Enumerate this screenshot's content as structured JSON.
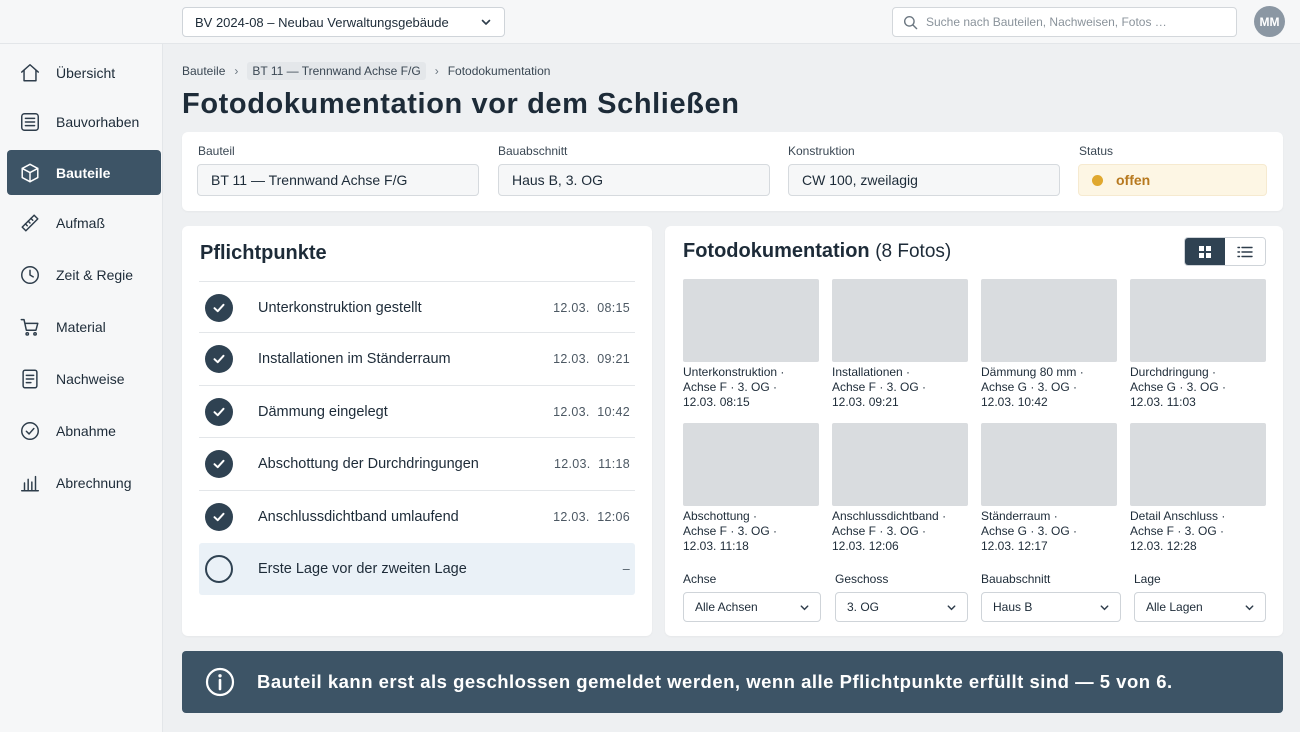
{
  "header": {
    "project_select": "BV 2024-08 – Neubau Verwaltungsgebäude",
    "search_placeholder": "Suche nach Bauteilen, Nachweisen, Fotos …",
    "avatar_initials": "MM"
  },
  "sidebar": {
    "items": [
      {
        "label": "Übersicht",
        "icon": "home-icon"
      },
      {
        "label": "Bauvorhaben",
        "icon": "building-icon"
      },
      {
        "label": "Bauteile",
        "icon": "cube-icon",
        "active": true
      },
      {
        "label": "Aufmaß",
        "icon": "ruler-icon"
      },
      {
        "label": "Zeit & Regie",
        "icon": "clock-icon"
      },
      {
        "label": "Material",
        "icon": "cart-icon"
      },
      {
        "label": "Nachweise",
        "icon": "document-icon"
      },
      {
        "label": "Abnahme",
        "icon": "check-circle-icon"
      },
      {
        "label": "Abrechnung",
        "icon": "bar-chart-icon"
      }
    ]
  },
  "breadcrumb": [
    "Bauteile",
    "BT 11 — Trennwand Achse F/G",
    "Fotodokumentation"
  ],
  "page_title": "Fotodokumentation vor dem Schließen",
  "info": {
    "bauteil_label": "Bauteil",
    "bauteil_value": "BT 11 — Trennwand Achse F/G",
    "bauabschnitt_label": "Bauabschnitt",
    "bauabschnitt_value": "Haus B, 3. OG",
    "konstruktion_label": "Konstruktion",
    "konstruktion_value": "CW 100, zweilagig",
    "status_label": "Status",
    "status_value": "offen",
    "status_color": "#e0a82e"
  },
  "checklist": {
    "title": "Pflichtpunkte",
    "items": [
      {
        "text": "Unterkonstruktion gestellt",
        "date": "12.03.",
        "time": "08:15",
        "done": true
      },
      {
        "text": "Installationen im Ständerraum",
        "date": "12.03.",
        "time": "09:21",
        "done": true
      },
      {
        "text": "Dämmung eingelegt",
        "date": "12.03.",
        "time": "10:42",
        "done": true
      },
      {
        "text": "Abschottung der Durchdringungen",
        "date": "12.03.",
        "time": "11:18",
        "done": true
      },
      {
        "text": "Anschlussdichtband umlaufend",
        "date": "12.03.",
        "time": "12:06",
        "done": true
      },
      {
        "text": "Erste Lage vor der zweiten Lage",
        "date": "",
        "time": "–",
        "done": false
      }
    ]
  },
  "photos": {
    "title": "Fotodokumentation",
    "count": "(8 Fotos)",
    "items": [
      {
        "l1": "Unterkonstruktion ·",
        "l2": "Achse F · 3. OG ·",
        "l3": "12.03. 08:15"
      },
      {
        "l1": "Installationen ·",
        "l2": "Achse F · 3. OG ·",
        "l3": "12.03. 09:21"
      },
      {
        "l1": "Dämmung 80 mm ·",
        "l2": "Achse G · 3. OG ·",
        "l3": "12.03. 10:42"
      },
      {
        "l1": "Durchdringung ·",
        "l2": "Achse G · 3. OG ·",
        "l3": "12.03. 11:03"
      },
      {
        "l1": "Abschottung ·",
        "l2": "Achse F · 3. OG ·",
        "l3": "12.03. 11:18"
      },
      {
        "l1": "Anschlussdichtband ·",
        "l2": "Achse F · 3. OG ·",
        "l3": "12.03. 12:06"
      },
      {
        "l1": "Ständerraum ·",
        "l2": "Achse G · 3. OG ·",
        "l3": "12.03. 12:17"
      },
      {
        "l1": "Detail Anschluss ·",
        "l2": "Achse F · 3. OG ·",
        "l3": "12.03. 12:28"
      }
    ],
    "filters": [
      {
        "label": "Achse",
        "value": "Alle Achsen"
      },
      {
        "label": "Geschoss",
        "value": "3. OG"
      },
      {
        "label": "Bauabschnitt",
        "value": "Haus B"
      },
      {
        "label": "Lage",
        "value": "Alle Lagen"
      }
    ]
  },
  "banner": {
    "text": "Bauteil kann erst als geschlossen gemeldet werden, wenn alle Pflichtpunkte erfüllt sind — 5 von 6."
  }
}
